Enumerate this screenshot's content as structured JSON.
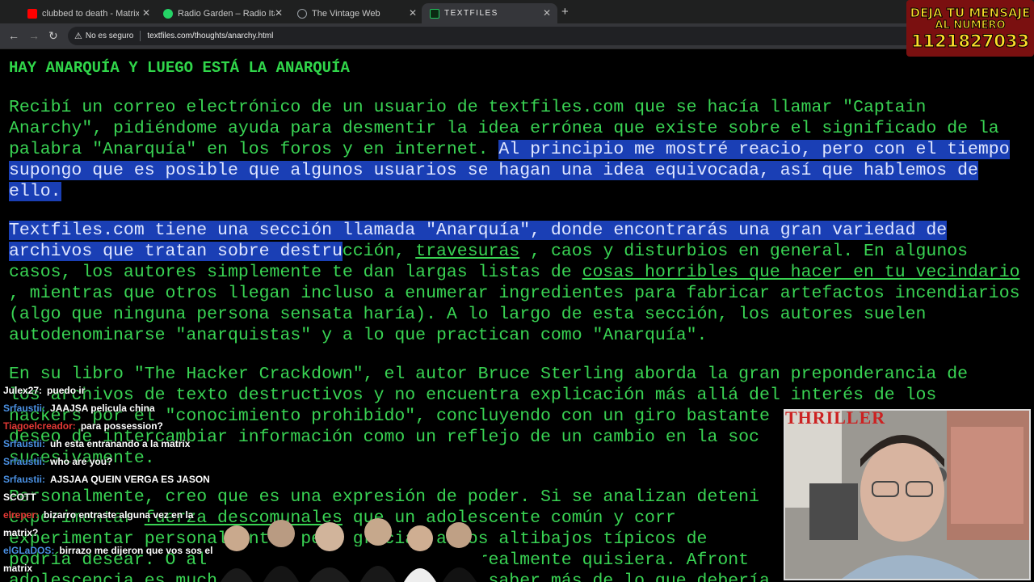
{
  "tabs": [
    {
      "title": "clubbed to death - Matrix soun",
      "favicon_color": "#ff0000",
      "active": false
    },
    {
      "title": "Radio Garden – Radio Ita Pora (",
      "favicon_color": "#25d366",
      "active": false
    },
    {
      "title": "The Vintage Web",
      "favicon_color": "#9aa0a6",
      "active": false
    },
    {
      "title": "TEXTFILES",
      "favicon_color": "#22c55e",
      "active": true
    }
  ],
  "toolbar": {
    "security_label": "No es seguro",
    "url": "textfiles.com/thoughts/anarchy.html"
  },
  "article": {
    "heading": "HAY ANARQUÍA Y LUEGO ESTÁ LA ANARQUÍA",
    "p1": {
      "l1": "Recibí un correo electrónico de un usuario de textfiles.com que se hacía llamar \"Captain",
      "l2": "Anarchy\", pidiéndome ayuda para desmentir la idea errónea que existe sobre el significado de la",
      "l3a": "palabra \"Anarquía\" en los foros y en internet. ",
      "l3b": "Al principio me mostré reacio, pero con el tiempo",
      "l4": "supongo que es posible que algunos usuarios se hagan una idea equivocada, así que hablemos de",
      "l5": "ello."
    },
    "p2": {
      "l1": "Textfiles.com tiene una sección llamada \"Anarquía\", donde encontrarás una gran variedad de",
      "l2a": "archivos que tratan sobre destru",
      "l2b": "cción, ",
      "l2link": "travesuras",
      "l2c": " , caos y disturbios en general. En algunos",
      "l3a": "casos, los autores simplemente te dan largas listas de ",
      "l3link": "cosas horribles que hacer en tu vecindario",
      "l4": ", mientras que otros llegan incluso a enumerar ingredientes para fabricar artefactos incendiarios",
      "l5": "(algo que ninguna persona sensata haría). A lo largo de esta sección, los autores suelen",
      "l6": "autodenominarse \"anarquistas\" y a lo que practican como \"Anarquía\"."
    },
    "p3": {
      "l1": "En su libro \"The Hacker Crackdown\", el autor Bruce Sterling aborda la gran preponderancia de",
      "l2": "los archivos de texto destructivos y no encuentra explicación más allá del interés de los",
      "l3": "hackers por el \"conocimiento prohibido\", concluyendo con un giro bastante",
      "l4": "deseo de intercambiar información como un reflejo de un cambio en la soc",
      "l5": "sucesivamente."
    },
    "p4": {
      "l1": "Personalmente, creo que es una expresión de poder. Si se analizan deteni",
      "l2a": "experimentar ",
      "l2link": "fuerza descomunales",
      "l2b": " que un adolescente común y corr",
      "l3": "experimentar personalmente, pero gracias a los altibajos típicos de",
      "l4": "podría desear. O al menos sabe que podría si realmente quisiera. Afront",
      "l5": "adolescencia es mucho más fácil cuando puedes saber más de lo que debería."
    }
  },
  "banner": {
    "line1": "DEJA TU MENSAJE",
    "line2": "AL NUMERO",
    "line3": "1121827033"
  },
  "chat": [
    {
      "user": "Julex27:",
      "text": "puedo ir",
      "color": "#ffffff"
    },
    {
      "user": "Srfaustii:",
      "text": "JAAJSA pelicula china",
      "color": "#4a90e2"
    },
    {
      "user": "Tiagoelcreador:",
      "text": "para possession?",
      "color": "#e53935"
    },
    {
      "user": "Srfaustii:",
      "text": "uh esta entranando a la matrix",
      "color": "#4a90e2"
    },
    {
      "user": "Srfaustii:",
      "text": "who are you?",
      "color": "#4a90e2"
    },
    {
      "user": "Srfaustii:",
      "text": "AJSJAA QUEIN VERGA ES JASON",
      "color": "#4a90e2"
    },
    {
      "user": "SCOTT",
      "text": "",
      "color": "#ffffff"
    },
    {
      "user": "elreper:",
      "text": "bizarro entraste alguna vez en la",
      "color": "#e53935"
    },
    {
      "user": "matrix?",
      "text": "",
      "color": "#ffffff"
    },
    {
      "user": "elGLaDOS:",
      "text": "birrazo me dijeron que vos sos el",
      "color": "#4a90e2"
    },
    {
      "user": "matrix",
      "text": "",
      "color": "#ffffff"
    }
  ],
  "overlay": {
    "thriller_logo": "THRILLER"
  }
}
